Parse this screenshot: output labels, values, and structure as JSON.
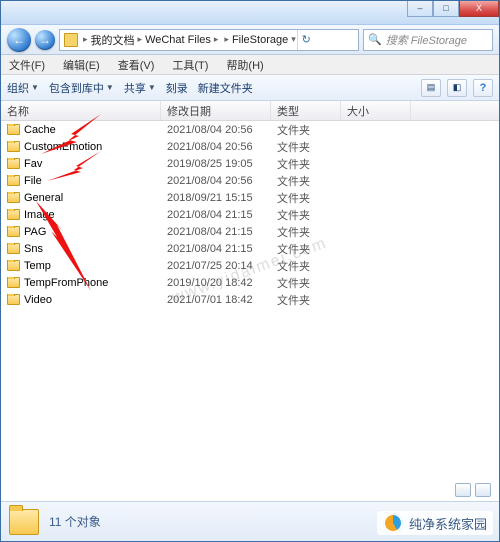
{
  "breadcrumb": {
    "root": "我的文档",
    "items": [
      "WeChat Files",
      "",
      "FileStorage"
    ],
    "refresh": "↻"
  },
  "search": {
    "placeholder": "搜索 FileStorage",
    "icon": "🔍"
  },
  "win_controls": {
    "min": "–",
    "max": "□",
    "close": "X"
  },
  "nav": {
    "back": "←",
    "fwd": "→"
  },
  "menus": [
    "文件(F)",
    "编辑(E)",
    "查看(V)",
    "工具(T)",
    "帮助(H)"
  ],
  "toolbar": {
    "organize": "组织",
    "include": "包含到库中",
    "share": "共享",
    "burn": "刻录",
    "newfolder": "新建文件夹"
  },
  "columns": {
    "name": "名称",
    "date": "修改日期",
    "type": "类型",
    "size": "大小"
  },
  "rows": [
    {
      "name": "Cache",
      "date": "2021/08/04 20:56",
      "type": "文件夹"
    },
    {
      "name": "CustomEmotion",
      "date": "2021/08/04 20:56",
      "type": "文件夹"
    },
    {
      "name": "Fav",
      "date": "2019/08/25 19:05",
      "type": "文件夹"
    },
    {
      "name": "File",
      "date": "2021/08/04 20:56",
      "type": "文件夹"
    },
    {
      "name": "General",
      "date": "2018/09/21 15:15",
      "type": "文件夹"
    },
    {
      "name": "Image",
      "date": "2021/08/04 21:15",
      "type": "文件夹"
    },
    {
      "name": "PAG",
      "date": "2021/08/04 21:15",
      "type": "文件夹"
    },
    {
      "name": "Sns",
      "date": "2021/08/04 21:15",
      "type": "文件夹"
    },
    {
      "name": "Temp",
      "date": "2021/07/25 20:14",
      "type": "文件夹"
    },
    {
      "name": "TempFromPhone",
      "date": "2019/10/20 18:42",
      "type": "文件夹"
    },
    {
      "name": "Video",
      "date": "2021/07/01 18:42",
      "type": "文件夹"
    }
  ],
  "status": {
    "count": "11 个对象"
  },
  "watermark_center": "www.yidaimei.com",
  "watermark_corner": "纯净系统家园"
}
